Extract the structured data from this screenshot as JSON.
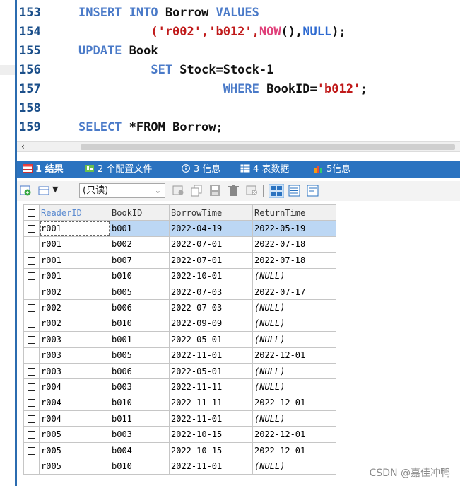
{
  "editor": {
    "lines": [
      {
        "num": "153",
        "tokens": [
          {
            "t": "INSERT INTO ",
            "c": "kw"
          },
          {
            "t": "Borrow ",
            "c": "tx"
          },
          {
            "t": "VALUES",
            "c": "kw"
          }
        ]
      },
      {
        "num": "154",
        "tokens": [
          {
            "t": "          ('r002','b012',",
            "c": "st"
          },
          {
            "t": "NOW",
            "c": "fn"
          },
          {
            "t": "(),",
            "c": "tx"
          },
          {
            "t": "NULL",
            "c": "nl"
          },
          {
            "t": ");",
            "c": "tx"
          }
        ]
      },
      {
        "num": "155",
        "tokens": [
          {
            "t": "UPDATE ",
            "c": "kw"
          },
          {
            "t": "Book",
            "c": "tx"
          }
        ]
      },
      {
        "num": "156",
        "tokens": [
          {
            "t": "          SET ",
            "c": "kw"
          },
          {
            "t": "Stock=Stock-1",
            "c": "tx"
          }
        ]
      },
      {
        "num": "157",
        "tokens": [
          {
            "t": "                    WHERE ",
            "c": "kw"
          },
          {
            "t": "BookID=",
            "c": "tx"
          },
          {
            "t": "'b012'",
            "c": "st"
          },
          {
            "t": ";",
            "c": "tx"
          }
        ]
      },
      {
        "num": "158",
        "tokens": []
      },
      {
        "num": "159",
        "tokens": [
          {
            "t": "SELECT ",
            "c": "kw"
          },
          {
            "t": "*FROM ",
            "c": "tx"
          },
          {
            "t": "Borrow",
            "c": "tx"
          },
          {
            "t": ";",
            "c": "tx"
          }
        ]
      }
    ]
  },
  "tabs": [
    {
      "num": "1",
      "label": "结果",
      "icon": "grid-result-icon",
      "active": true
    },
    {
      "num": "2",
      "label": "个配置文件",
      "icon": "profile-icon",
      "active": false
    },
    {
      "num": "3",
      "label": "信息",
      "icon": "info-icon",
      "active": false
    },
    {
      "num": "4",
      "label": "表数据",
      "icon": "table-data-icon",
      "active": false
    },
    {
      "num": "5",
      "label": "信息",
      "icon": "info-chart-icon",
      "active": false
    }
  ],
  "toolbar": {
    "readonly_value": "(只读)"
  },
  "grid": {
    "columns": [
      "ReaderID",
      "BookID",
      "BorrowTime",
      "ReturnTime"
    ],
    "rows": [
      [
        "r001",
        "b001",
        "2022-04-19",
        "2022-05-19"
      ],
      [
        "r001",
        "b002",
        "2022-07-01",
        "2022-07-18"
      ],
      [
        "r001",
        "b007",
        "2022-07-01",
        "2022-07-18"
      ],
      [
        "r001",
        "b010",
        "2022-10-01",
        "(NULL)"
      ],
      [
        "r002",
        "b005",
        "2022-07-03",
        "2022-07-17"
      ],
      [
        "r002",
        "b006",
        "2022-07-03",
        "(NULL)"
      ],
      [
        "r002",
        "b010",
        "2022-09-09",
        "(NULL)"
      ],
      [
        "r003",
        "b001",
        "2022-05-01",
        "(NULL)"
      ],
      [
        "r003",
        "b005",
        "2022-11-01",
        "2022-12-01"
      ],
      [
        "r003",
        "b006",
        "2022-05-01",
        "(NULL)"
      ],
      [
        "r004",
        "b003",
        "2022-11-11",
        "(NULL)"
      ],
      [
        "r004",
        "b010",
        "2022-11-11",
        "2022-12-01"
      ],
      [
        "r004",
        "b011",
        "2022-11-01",
        "(NULL)"
      ],
      [
        "r005",
        "b003",
        "2022-10-15",
        "2022-12-01"
      ],
      [
        "r005",
        "b004",
        "2022-10-15",
        "2022-12-01"
      ],
      [
        "r005",
        "b010",
        "2022-11-01",
        "(NULL)"
      ]
    ]
  },
  "watermark": "CSDN @嘉佳冲鸭",
  "colors": {
    "keyword": "#4a7ac8",
    "string": "#c01a1a",
    "function": "#e0407a",
    "tab_bar": "#2b73c0",
    "selected_row": "#bcd7f4"
  }
}
